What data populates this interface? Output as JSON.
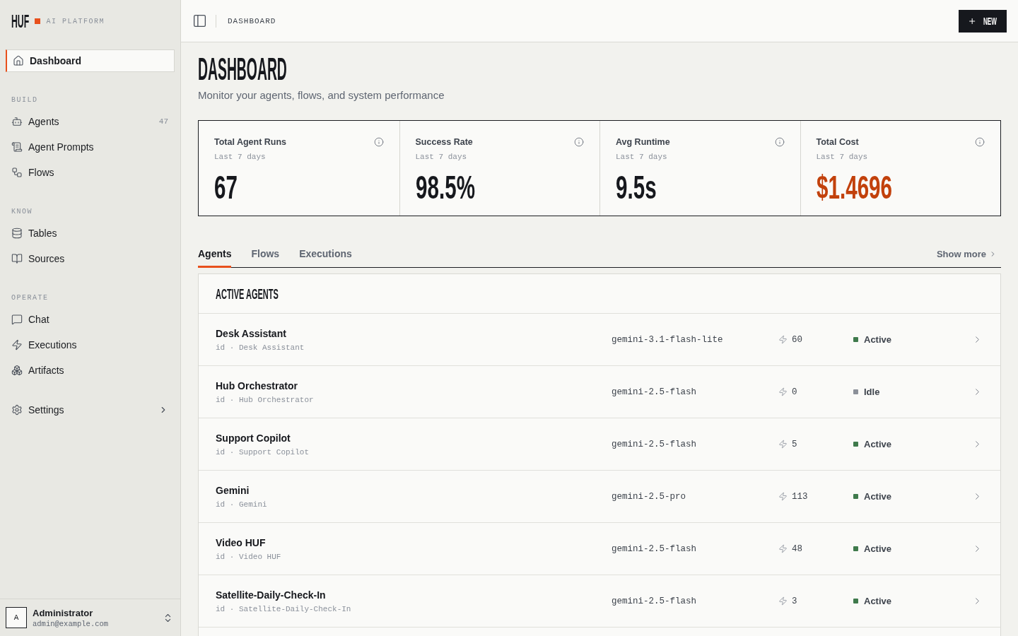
{
  "brand": {
    "logo": "HUF",
    "tagline": "AI PLATFORM"
  },
  "sidebar": {
    "top_items": [
      {
        "label": "Dashboard",
        "selected": true
      }
    ],
    "sections": [
      {
        "heading": "BUILD",
        "items": [
          {
            "label": "Agents",
            "count": "47",
            "selected": false
          },
          {
            "label": "Agent Prompts",
            "selected": false
          },
          {
            "label": "Flows",
            "selected": false
          }
        ]
      },
      {
        "heading": "KNOW",
        "items": [
          {
            "label": "Tables",
            "selected": false
          },
          {
            "label": "Sources",
            "selected": false
          }
        ]
      },
      {
        "heading": "OPERATE",
        "items": [
          {
            "label": "Chat",
            "selected": false
          },
          {
            "label": "Executions",
            "selected": false
          },
          {
            "label": "Artifacts",
            "selected": false
          }
        ]
      }
    ],
    "bottom_items": [
      {
        "label": "Settings",
        "selected": false,
        "expanded": false
      }
    ]
  },
  "user": {
    "avatar": "A",
    "name": "Administrator",
    "email": "admin@example.com"
  },
  "topbar": {
    "breadcrumb": "DASHBOARD",
    "new_button": "NEW"
  },
  "page": {
    "title": "DASHBOARD",
    "subtitle": "Monitor your agents, flows, and system performance"
  },
  "stats": [
    {
      "title": "Total Agent Runs",
      "period": "Last 7 days",
      "value": "67",
      "accent": false
    },
    {
      "title": "Success Rate",
      "period": "Last 7 days",
      "value": "98.5%",
      "accent": false
    },
    {
      "title": "Avg Runtime",
      "period": "Last 7 days",
      "value": "9.5s",
      "accent": false
    },
    {
      "title": "Total Cost",
      "period": "Last 7 days",
      "value": "$1.4696",
      "accent": true
    }
  ],
  "tabs": [
    {
      "label": "Agents",
      "selected": true
    },
    {
      "label": "Flows",
      "selected": false
    },
    {
      "label": "Executions",
      "selected": false
    }
  ],
  "show_more": "Show more",
  "agents_panel": {
    "title": "ACTIVE AGENTS",
    "rows": [
      {
        "name": "Desk Assistant",
        "id_line": "id · Desk Assistant",
        "model": "gemini-3.1-flash-lite",
        "runs": "60",
        "status": "Active",
        "color": "#3f7a4c"
      },
      {
        "name": "Hub Orchestrator",
        "id_line": "id · Hub Orchestrator",
        "model": "gemini-2.5-flash",
        "runs": "0",
        "status": "Idle",
        "color": "#8b9099"
      },
      {
        "name": "Support Copilot",
        "id_line": "id · Support Copilot",
        "model": "gemini-2.5-flash",
        "runs": "5",
        "status": "Active",
        "color": "#3f7a4c"
      },
      {
        "name": "Gemini",
        "id_line": "id · Gemini",
        "model": "gemini-2.5-pro",
        "runs": "113",
        "status": "Active",
        "color": "#3f7a4c"
      },
      {
        "name": "Video HUF",
        "id_line": "id · Video HUF",
        "model": "gemini-2.5-flash",
        "runs": "48",
        "status": "Active",
        "color": "#3f7a4c"
      },
      {
        "name": "Satellite-Daily-Check-In",
        "id_line": "id · Satellite-Daily-Check-In",
        "model": "gemini-2.5-flash",
        "runs": "3",
        "status": "Active",
        "color": "#3f7a4c"
      }
    ]
  }
}
